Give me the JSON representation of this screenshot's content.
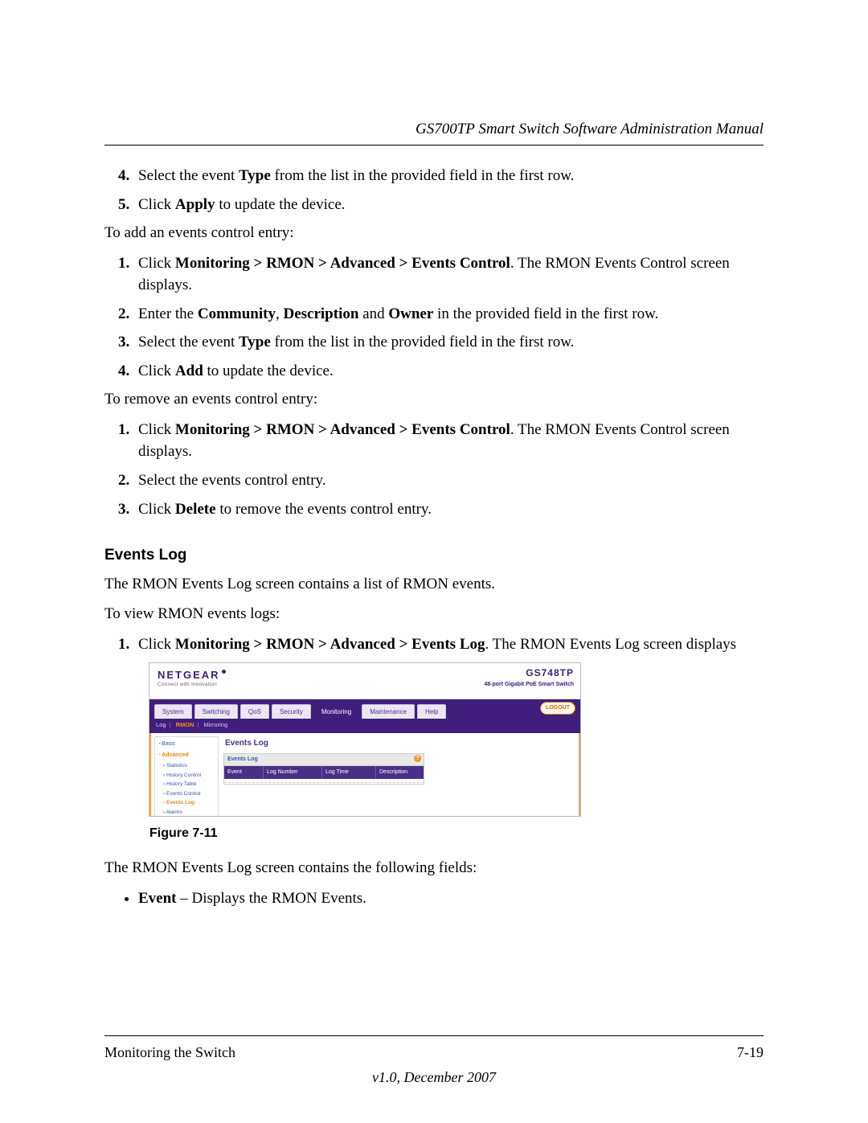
{
  "header": {
    "title": "GS700TP Smart Switch Software Administration Manual"
  },
  "body": {
    "list_a_start": 4,
    "list_a": [
      {
        "pre": "Select the event ",
        "b1": "Type",
        "post": " from the list in the provided field in the first row."
      },
      {
        "pre": "Click ",
        "b1": "Apply",
        "post": " to update the device."
      }
    ],
    "para_add": "To add an events control entry:",
    "list_b": [
      {
        "pre": "Click ",
        "b1": "Monitoring > RMON > Advanced > Events Control",
        "post": ". The RMON Events Control screen displays."
      },
      {
        "pre": "Enter the ",
        "b1": "Community",
        "mid1": ", ",
        "b2": "Description",
        "mid2": " and ",
        "b3": "Owner",
        "post": " in the provided field in the first row."
      },
      {
        "pre": "Select the event ",
        "b1": "Type",
        "post": " from the list in the provided field in the first row."
      },
      {
        "pre": "Click ",
        "b1": "Add",
        "post": " to update the device."
      }
    ],
    "para_remove": "To remove an events control entry:",
    "list_c": [
      {
        "pre": "Click ",
        "b1": "Monitoring > RMON > Advanced > Events Control",
        "post": ". The RMON Events Control screen displays."
      },
      {
        "pre": "Select the events control entry.",
        "b1": "",
        "post": ""
      },
      {
        "pre": "Click ",
        "b1": "Delete",
        "post": " to remove the events control entry."
      }
    ],
    "section_head": "Events Log",
    "para_intro": "The RMON Events Log screen contains a list of RMON events.",
    "para_view": "To view RMON events logs:",
    "list_d": [
      {
        "pre": "Click ",
        "b1": "Monitoring > RMON > Advanced > Events Log",
        "post": ". The RMON Events Log screen displays"
      }
    ],
    "figure_caption": "Figure 7-11",
    "para_fields": "The RMON Events Log screen contains the following fields:",
    "bullet_1_b": "Event",
    "bullet_1_post": " – Displays the RMON Events."
  },
  "screenshot": {
    "logo": "NETGEAR",
    "tagline": "Connect with Innovation",
    "product_model": "GS748TP",
    "product_desc": "48-port Gigabit PoE Smart Switch",
    "tabs": [
      "System",
      "Switching",
      "QoS",
      "Security",
      "Monitoring",
      "Maintenance",
      "Help"
    ],
    "active_tab": "Monitoring",
    "logout": "LOGOUT",
    "subnav": [
      "Log",
      "RMON",
      "Mirroring"
    ],
    "subnav_active": "RMON",
    "sidebar": {
      "basic": "Basic",
      "advanced": "Advanced",
      "items": [
        "Statistics",
        "History Control",
        "History Table",
        "Events Control",
        "Events Log",
        "Alarms"
      ],
      "active_item": "Events Log"
    },
    "content_title": "Events Log",
    "table_title": "Events Log",
    "columns": [
      "Event",
      "Log Number",
      "Log Time",
      "Description"
    ]
  },
  "footer": {
    "left": "Monitoring the Switch",
    "right": "7-19",
    "version": "v1.0, December 2007"
  }
}
